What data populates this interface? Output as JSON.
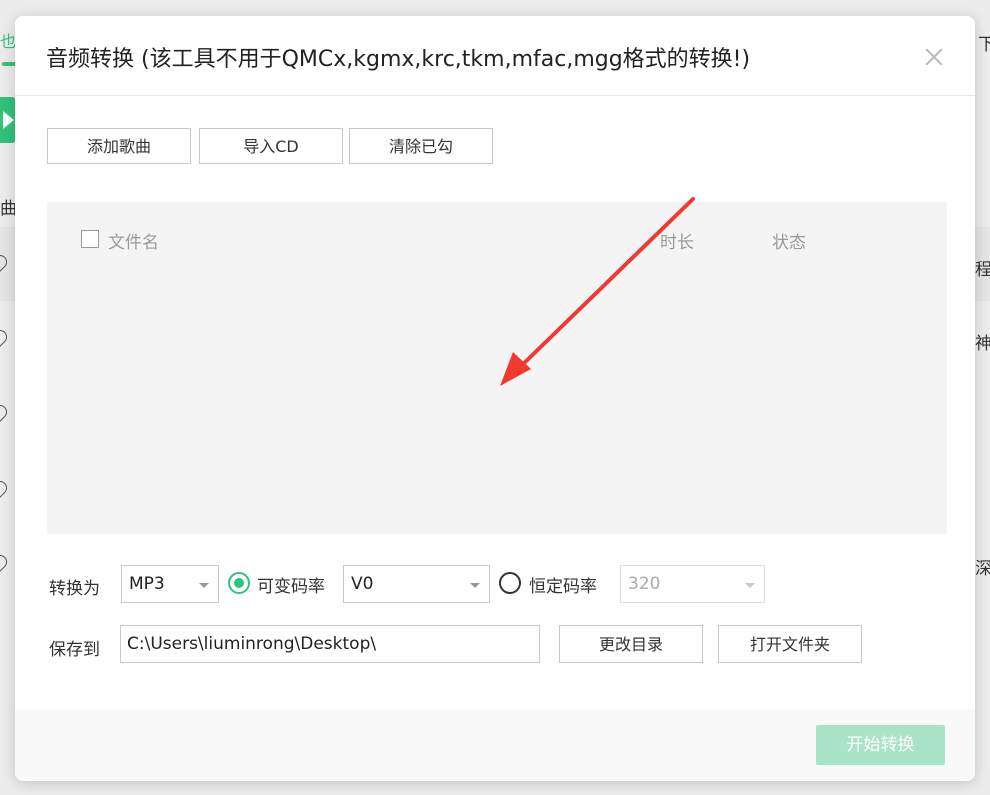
{
  "background": {
    "tab_fragment": "也",
    "sidebar_fragment": "曲",
    "right_top_fragment": "下",
    "right_items": [
      "程",
      "神",
      "深"
    ]
  },
  "dialog": {
    "title": "音频转换 (该工具不用于QMCx,kgmx,krc,tkm,mfac,mgg格式的转换!)",
    "close_icon": "close-icon",
    "toolbar": {
      "add_song": "添加歌曲",
      "import_cd": "导入CD",
      "clear_checked": "清除已勾"
    },
    "file_list": {
      "columns": {
        "filename": "文件名",
        "duration": "时长",
        "status": "状态"
      },
      "rows": []
    },
    "convert": {
      "label": "转换为",
      "format": "MP3",
      "vbr_label": "可变码率",
      "vbr_selected": true,
      "vbr_value": "V0",
      "cbr_label": "恒定码率",
      "cbr_selected": false,
      "cbr_value": "320"
    },
    "save": {
      "label": "保存到",
      "path": "C:\\Users\\liuminrong\\Desktop\\",
      "change_dir": "更改目录",
      "open_folder": "打开文件夹"
    },
    "start_button": "开始转换",
    "colors": {
      "accent": "#31c27c",
      "start_disabled": "#a9e4c7",
      "annotation_arrow": "#f03a2f"
    }
  }
}
